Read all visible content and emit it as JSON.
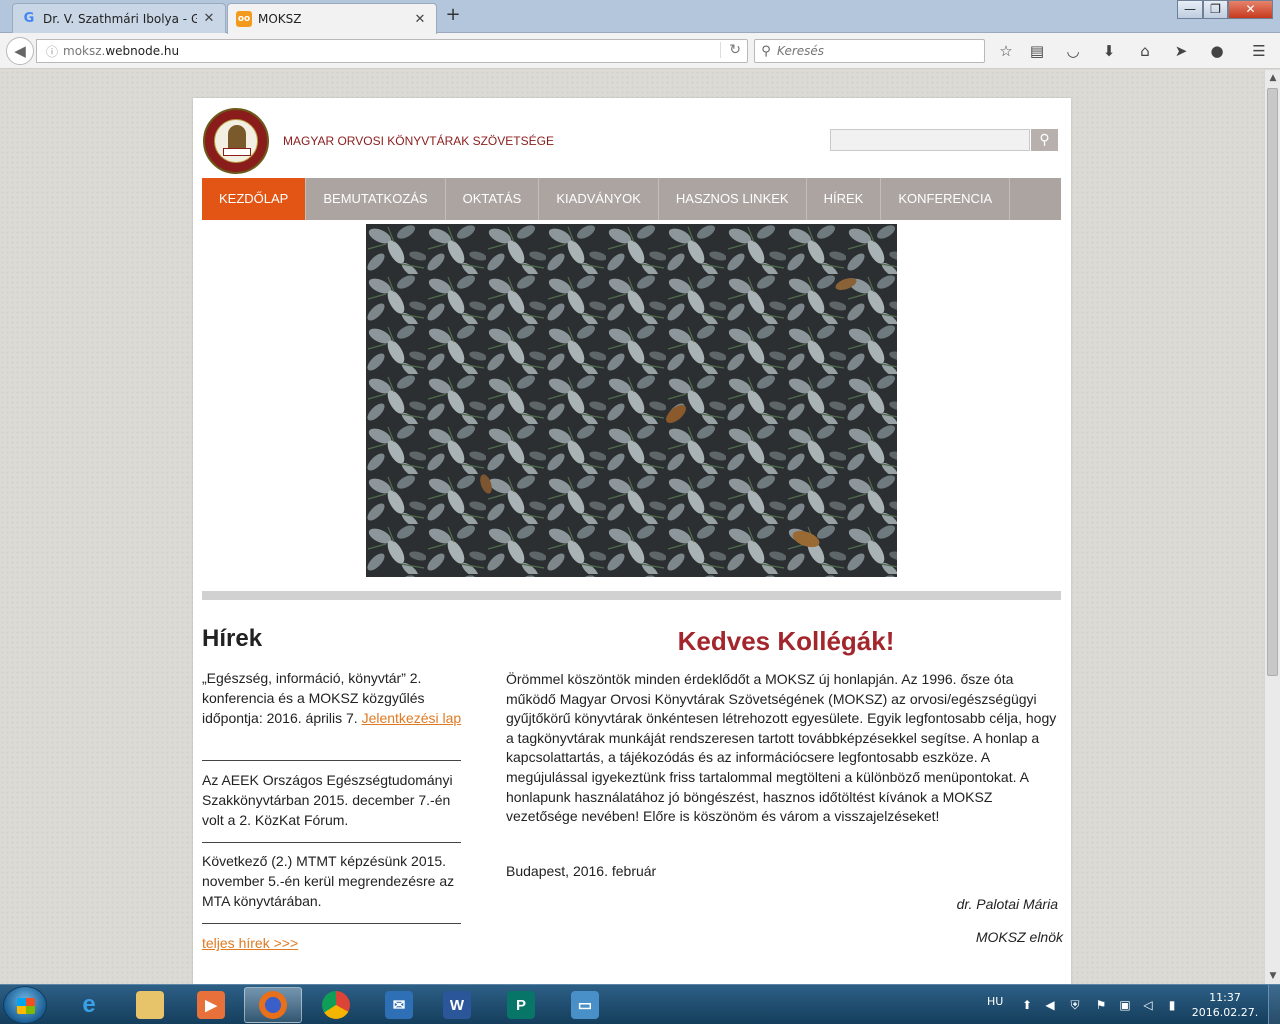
{
  "browser": {
    "tabs": [
      {
        "title": "Dr. V. Szathmári Ibolya - G...",
        "favicon": "G",
        "active": false
      },
      {
        "title": "MOKSZ",
        "favicon": "oo",
        "active": true
      }
    ],
    "window_buttons": {
      "minimize": "—",
      "maximize": "❐",
      "close": "✕"
    },
    "url": {
      "prefix": "moksz.",
      "host": "webnode.hu"
    },
    "search_placeholder": "Keresés",
    "toolbar_icons": [
      "bookmark-star-icon",
      "reading-list-icon",
      "pocket-icon",
      "download-icon",
      "home-icon",
      "send-icon",
      "chat-icon",
      "menu-icon"
    ]
  },
  "site": {
    "title": "MAGYAR ORVOSI KÖNYVTÁRAK SZÖVETSÉGE",
    "menu": [
      {
        "label": "KEZDŐLAP",
        "active": true
      },
      {
        "label": "BEMUTATKOZÁS",
        "active": false
      },
      {
        "label": "OKTATÁS",
        "active": false
      },
      {
        "label": "KIADVÁNYOK",
        "active": false
      },
      {
        "label": "HASZNOS LINKEK",
        "active": false
      },
      {
        "label": "HÍREK",
        "active": false
      },
      {
        "label": "KONFERENCIA",
        "active": false
      }
    ],
    "news": {
      "title": "Hírek",
      "items": [
        {
          "text": "„Egészség, információ, könyvtár” 2. konferencia és a MOKSZ közgyűlés időpontja: 2016. április 7.",
          "link": "Jelentkezési lap"
        },
        {
          "text": "Az AEEK Országos Egészségtudományi Szakkönyvtárban 2015. december 7.-én volt a 2. KözKat Fórum."
        },
        {
          "text": "Következő (2.) MTMT képzésünk 2015. november 5.-én kerül megrendezésre az MTA könyvtárában."
        }
      ],
      "more_link": "teljes hírek >>>"
    },
    "welcome": {
      "title": "Kedves Kollégák!",
      "body": "Örömmel köszöntök minden érdeklődőt a MOKSZ új honlapján. Az 1996. ősze óta működő Magyar Orvosi Könyvtárak Szövetségének (MOKSZ) az orvosi/egészségügyi gyűjtőkörű könyvtárak önkéntesen létrehozott egyesülete. Egyik legfontosabb célja, hogy a tagkönyvtárak munkáját rendszeresen tartott továbbképzésekkel segítse. A honlap a kapcsolattartás, a tájékozódás és az információcsere legfontosabb eszköze. A megújulással igyekeztünk friss tartalommal megtölteni a különböző menüpontokat. A honlapunk használatához jó böngészést, hasznos időtöltést kívánok a MOKSZ vezetősége nevében! Előre is köszönöm és várom a visszajelzéseket!",
      "date": "Budapest, 2016. február",
      "signature": "dr. Palotai Mária",
      "role": "MOKSZ elnök"
    },
    "colors": {
      "accent": "#e35514",
      "menu_bg": "#aba4a1",
      "title_red": "#a3262c",
      "link": "#e07a22"
    }
  },
  "taskbar": {
    "apps": [
      "internet-explorer-icon",
      "file-explorer-icon",
      "media-player-icon",
      "firefox-icon",
      "chrome-icon",
      "outlook-icon",
      "word-icon",
      "publisher-icon",
      "photo-viewer-icon"
    ],
    "language": "HU",
    "time": "11:37",
    "date": "2016.02.27."
  }
}
